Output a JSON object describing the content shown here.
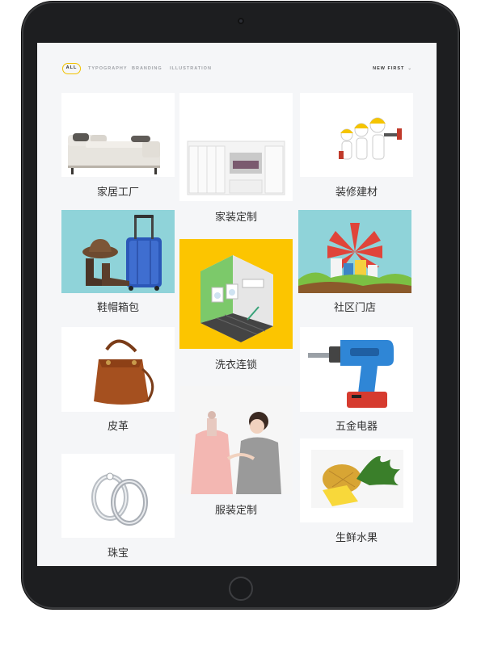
{
  "filters": [
    {
      "label": "ALL",
      "active": true
    },
    {
      "label": "TYPOGRAPHY",
      "active": false
    },
    {
      "label": "BRANDING",
      "active": false
    },
    {
      "label": "ILLUSTRATION",
      "active": false
    }
  ],
  "sort": {
    "label": "NEW FIRST",
    "icon": "chevron-down-icon"
  },
  "colors": {
    "accent": "#f2c200",
    "teal": "#8fd3d9",
    "yellow": "#fcc500"
  },
  "cards": [
    {
      "label": "家居工厂",
      "icon": "sofa-image"
    },
    {
      "label": "家装定制",
      "icon": "wardrobe-image"
    },
    {
      "label": "装修建材",
      "icon": "workers-image"
    },
    {
      "label": "鞋帽箱包",
      "icon": "luggage-image"
    },
    {
      "label": "洗衣连锁",
      "icon": "laundry-room-image"
    },
    {
      "label": "社区门店",
      "icon": "town-image"
    },
    {
      "label": "皮革",
      "icon": "handbag-image"
    },
    {
      "label": "五金电器",
      "icon": "drill-image"
    },
    {
      "label": "服装定制",
      "icon": "tailor-image"
    },
    {
      "label": "珠宝",
      "icon": "rings-image"
    },
    {
      "label": "生鲜水果",
      "icon": "pineapple-image"
    }
  ]
}
